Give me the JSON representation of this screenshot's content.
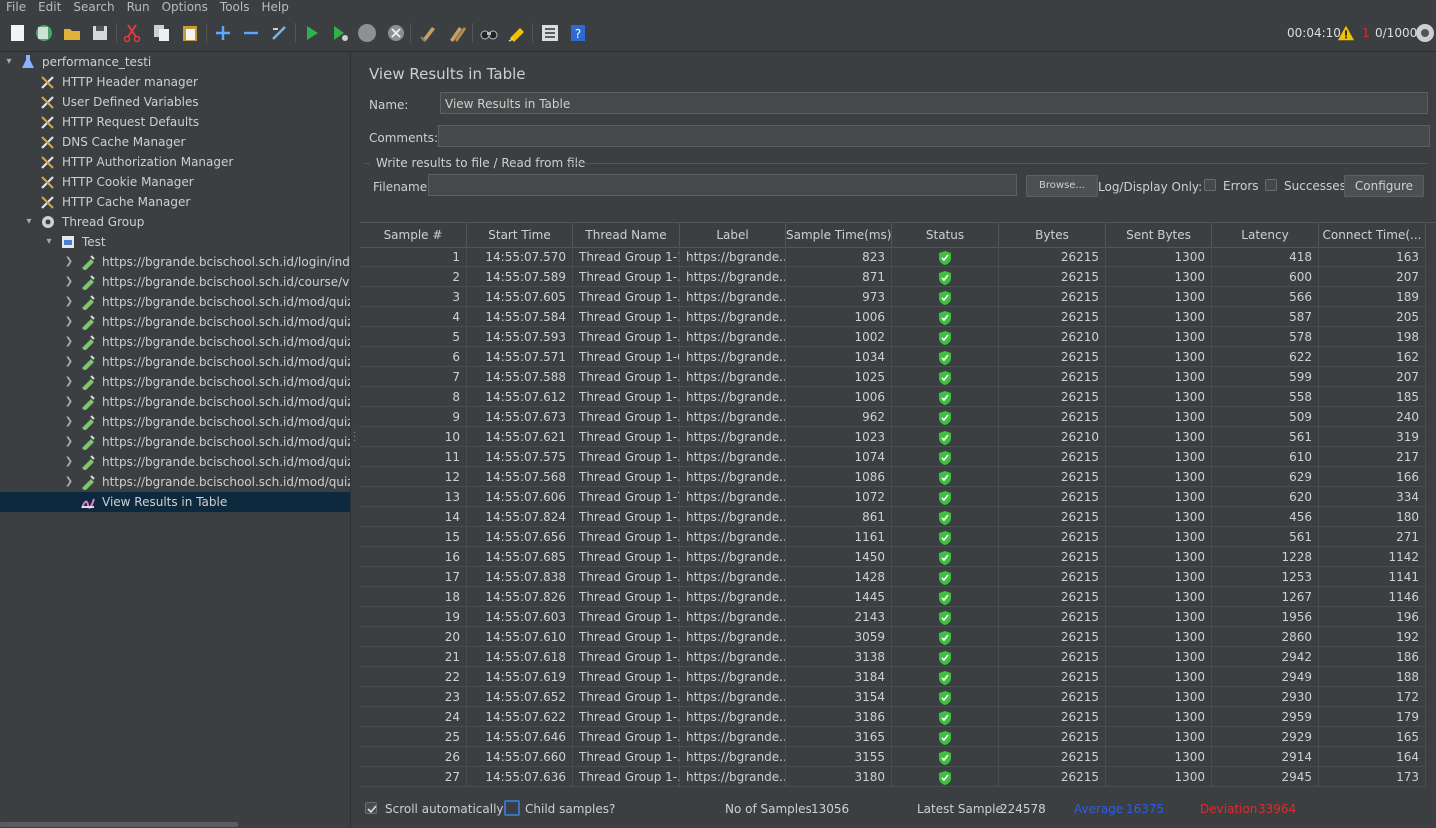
{
  "menu": [
    "File",
    "Edit",
    "Search",
    "Run",
    "Options",
    "Tools",
    "Help"
  ],
  "status": {
    "elapsed": "00:04:10",
    "warnings": "1",
    "threads": "0/1000"
  },
  "tree": [
    {
      "label": "performance_testi",
      "icon": "test-plan-icon",
      "arrow": "down"
    },
    {
      "label": "HTTP Header manager",
      "icon": "config-tool-icon",
      "arrow": ""
    },
    {
      "label": "User Defined Variables",
      "icon": "config-tool-icon",
      "arrow": ""
    },
    {
      "label": "HTTP Request Defaults",
      "icon": "config-tool-icon",
      "arrow": ""
    },
    {
      "label": "DNS Cache Manager",
      "icon": "config-tool-icon",
      "arrow": ""
    },
    {
      "label": "HTTP Authorization Manager",
      "icon": "config-tool-icon",
      "arrow": ""
    },
    {
      "label": "HTTP Cookie Manager",
      "icon": "config-tool-icon",
      "arrow": ""
    },
    {
      "label": "HTTP Cache Manager",
      "icon": "config-tool-icon",
      "arrow": ""
    },
    {
      "label": "Thread Group",
      "icon": "gear-icon",
      "arrow": "down"
    },
    {
      "label": "Test",
      "icon": "controller-icon",
      "arrow": "down"
    },
    {
      "label": "https://bgrande.bcischool.sch.id/login/index.p",
      "icon": "sampler-icon",
      "arrow": "right"
    },
    {
      "label": "https://bgrande.bcischool.sch.id/course/view.p",
      "icon": "sampler-icon",
      "arrow": "right"
    },
    {
      "label": "https://bgrande.bcischool.sch.id/mod/quiz/vie",
      "icon": "sampler-icon",
      "arrow": "right"
    },
    {
      "label": "https://bgrande.bcischool.sch.id/mod/quiz/vie",
      "icon": "sampler-icon",
      "arrow": "right"
    },
    {
      "label": "https://bgrande.bcischool.sch.id/mod/quiz/vie",
      "icon": "sampler-icon",
      "arrow": "right"
    },
    {
      "label": "https://bgrande.bcischool.sch.id/mod/quiz/vie",
      "icon": "sampler-icon",
      "arrow": "right"
    },
    {
      "label": "https://bgrande.bcischool.sch.id/mod/quiz/vie",
      "icon": "sampler-icon",
      "arrow": "right"
    },
    {
      "label": "https://bgrande.bcischool.sch.id/mod/quiz/vie",
      "icon": "sampler-icon",
      "arrow": "right"
    },
    {
      "label": "https://bgrande.bcischool.sch.id/mod/quiz/sta",
      "icon": "sampler-icon",
      "arrow": "right"
    },
    {
      "label": "https://bgrande.bcischool.sch.id/mod/quiz/pr",
      "icon": "sampler-icon",
      "arrow": "right"
    },
    {
      "label": "https://bgrande.bcischool.sch.id/mod/quiz/pr",
      "icon": "sampler-icon",
      "arrow": "right"
    },
    {
      "label": "https://bgrande.bcischool.sch.id/mod/quiz/pr",
      "icon": "sampler-icon",
      "arrow": "right"
    },
    {
      "label": "View Results in Table",
      "icon": "listener-icon",
      "arrow": "",
      "selected": true
    }
  ],
  "panel": {
    "title": "View Results in Table",
    "name_label": "Name:",
    "name_value": "View Results in Table",
    "comments_label": "Comments:",
    "comments_value": "",
    "file_group": "Write results to file / Read from file",
    "filename_label": "Filename",
    "filename_value": "",
    "browse": "Browse...",
    "log_display": "Log/Display Only:",
    "errors": "Errors",
    "successes": "Successes",
    "configure": "Configure"
  },
  "table": {
    "columns": [
      "Sample #",
      "Start Time",
      "Thread Name",
      "Label",
      "Sample Time(ms)",
      "Status",
      "Bytes",
      "Sent Bytes",
      "Latency",
      "Connect Time(..."
    ],
    "rows": [
      [
        "1",
        "14:55:07.570",
        "Thread Group 1-1",
        "https://bgrande...",
        "823",
        "ok",
        "26215",
        "1300",
        "418",
        "163"
      ],
      [
        "2",
        "14:55:07.589",
        "Thread Group 1-...",
        "https://bgrande...",
        "871",
        "ok",
        "26215",
        "1300",
        "600",
        "207"
      ],
      [
        "3",
        "14:55:07.605",
        "Thread Group 1-...",
        "https://bgrande...",
        "973",
        "ok",
        "26215",
        "1300",
        "566",
        "189"
      ],
      [
        "4",
        "14:55:07.584",
        "Thread Group 1-...",
        "https://bgrande...",
        "1006",
        "ok",
        "26215",
        "1300",
        "587",
        "205"
      ],
      [
        "5",
        "14:55:07.593",
        "Thread Group 1-...",
        "https://bgrande...",
        "1002",
        "ok",
        "26210",
        "1300",
        "578",
        "198"
      ],
      [
        "6",
        "14:55:07.571",
        "Thread Group 1-6",
        "https://bgrande...",
        "1034",
        "ok",
        "26215",
        "1300",
        "622",
        "162"
      ],
      [
        "7",
        "14:55:07.588",
        "Thread Group 1-...",
        "https://bgrande...",
        "1025",
        "ok",
        "26215",
        "1300",
        "599",
        "207"
      ],
      [
        "8",
        "14:55:07.612",
        "Thread Group 1-...",
        "https://bgrande...",
        "1006",
        "ok",
        "26215",
        "1300",
        "558",
        "185"
      ],
      [
        "9",
        "14:55:07.673",
        "Thread Group 1-...",
        "https://bgrande...",
        "962",
        "ok",
        "26215",
        "1300",
        "509",
        "240"
      ],
      [
        "10",
        "14:55:07.621",
        "Thread Group 1-...",
        "https://bgrande...",
        "1023",
        "ok",
        "26210",
        "1300",
        "561",
        "319"
      ],
      [
        "11",
        "14:55:07.575",
        "Thread Group 1-...",
        "https://bgrande...",
        "1074",
        "ok",
        "26215",
        "1300",
        "610",
        "217"
      ],
      [
        "12",
        "14:55:07.568",
        "Thread Group 1-...",
        "https://bgrande...",
        "1086",
        "ok",
        "26215",
        "1300",
        "629",
        "166"
      ],
      [
        "13",
        "14:55:07.606",
        "Thread Group 1-7",
        "https://bgrande...",
        "1072",
        "ok",
        "26215",
        "1300",
        "620",
        "334"
      ],
      [
        "14",
        "14:55:07.824",
        "Thread Group 1-...",
        "https://bgrande...",
        "861",
        "ok",
        "26215",
        "1300",
        "456",
        "180"
      ],
      [
        "15",
        "14:55:07.656",
        "Thread Group 1-...",
        "https://bgrande...",
        "1161",
        "ok",
        "26215",
        "1300",
        "561",
        "271"
      ],
      [
        "16",
        "14:55:07.685",
        "Thread Group 1-...",
        "https://bgrande...",
        "1450",
        "ok",
        "26215",
        "1300",
        "1228",
        "1142"
      ],
      [
        "17",
        "14:55:07.838",
        "Thread Group 1-...",
        "https://bgrande...",
        "1428",
        "ok",
        "26215",
        "1300",
        "1253",
        "1141"
      ],
      [
        "18",
        "14:55:07.826",
        "Thread Group 1-...",
        "https://bgrande...",
        "1445",
        "ok",
        "26215",
        "1300",
        "1267",
        "1146"
      ],
      [
        "19",
        "14:55:07.603",
        "Thread Group 1-...",
        "https://bgrande...",
        "2143",
        "ok",
        "26215",
        "1300",
        "1956",
        "196"
      ],
      [
        "20",
        "14:55:07.610",
        "Thread Group 1-...",
        "https://bgrande...",
        "3059",
        "ok",
        "26215",
        "1300",
        "2860",
        "192"
      ],
      [
        "21",
        "14:55:07.618",
        "Thread Group 1-...",
        "https://bgrande...",
        "3138",
        "ok",
        "26215",
        "1300",
        "2942",
        "186"
      ],
      [
        "22",
        "14:55:07.619",
        "Thread Group 1-...",
        "https://bgrande...",
        "3184",
        "ok",
        "26215",
        "1300",
        "2949",
        "188"
      ],
      [
        "23",
        "14:55:07.652",
        "Thread Group 1-...",
        "https://bgrande...",
        "3154",
        "ok",
        "26215",
        "1300",
        "2930",
        "172"
      ],
      [
        "24",
        "14:55:07.622",
        "Thread Group 1-...",
        "https://bgrande...",
        "3186",
        "ok",
        "26215",
        "1300",
        "2959",
        "179"
      ],
      [
        "25",
        "14:55:07.646",
        "Thread Group 1-...",
        "https://bgrande...",
        "3165",
        "ok",
        "26215",
        "1300",
        "2929",
        "165"
      ],
      [
        "26",
        "14:55:07.660",
        "Thread Group 1-...",
        "https://bgrande...",
        "3155",
        "ok",
        "26215",
        "1300",
        "2914",
        "164"
      ],
      [
        "27",
        "14:55:07.636",
        "Thread Group 1-...",
        "https://bgrande...",
        "3180",
        "ok",
        "26215",
        "1300",
        "2945",
        "173"
      ]
    ]
  },
  "footer": {
    "scroll_auto": "Scroll automatically?",
    "child_samples": "Child samples?",
    "no_samples_label": "No of Samples",
    "no_samples_value": "13056",
    "latest_label": "Latest Sample",
    "latest_value": "224578",
    "average_label": "Average",
    "average_value": "16375",
    "deviation_label": "Deviation",
    "deviation_value": "33964"
  },
  "colors": {
    "accent_blue": "#2b5ee8",
    "deviation_red": "#e02a2a",
    "ok_green": "#3fbf3f",
    "selection": "#0d293e"
  }
}
